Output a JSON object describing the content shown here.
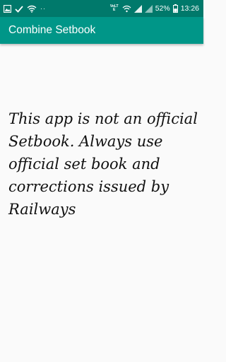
{
  "status_bar": {
    "left_icons": [
      "gallery-icon",
      "check-icon",
      "wifi-icon"
    ],
    "dots": "··",
    "volte_label": "VoLTE",
    "signal_icons": [
      "wifi-calling-icon",
      "signal-bars-icon",
      "signal-bars-icon"
    ],
    "battery_percent": "52%",
    "time": "13:26"
  },
  "app_bar": {
    "title": "Combine Setbook"
  },
  "main": {
    "disclaimer": "This app is not an official Setbook. Always use official set book and corrections issued by Railways"
  },
  "colors": {
    "status_bar": "#00796b",
    "app_bar": "#009688",
    "background": "#fafafa",
    "text": "#111111"
  }
}
